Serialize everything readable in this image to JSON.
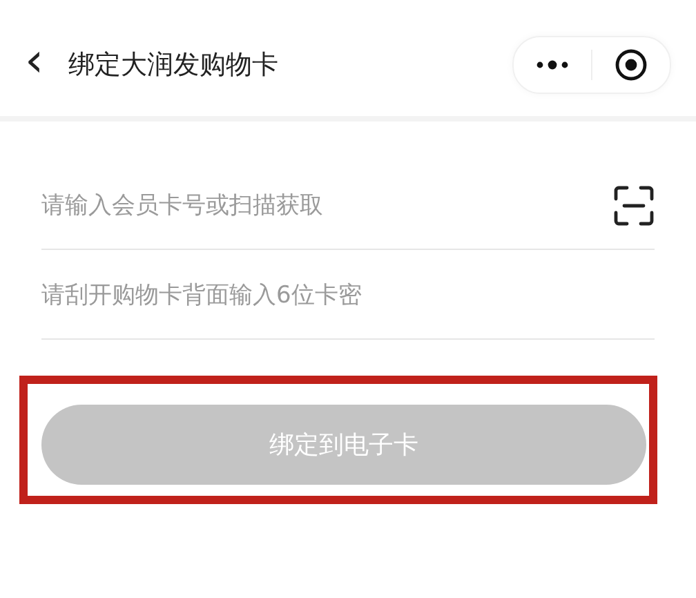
{
  "nav_bar": {
    "back_icon": "‹",
    "title": "绑定大润发购物卡"
  },
  "fields": [
    {
      "kind": "scan",
      "placeholder": "请输入会员卡号或扫描获取"
    },
    {
      "kind": "plain",
      "placeholder": "请刮开购物卡背面输入6位卡密"
    }
  ],
  "submit_button": {
    "label": "绑定到电子卡",
    "disabled": true,
    "highlighted": true
  }
}
